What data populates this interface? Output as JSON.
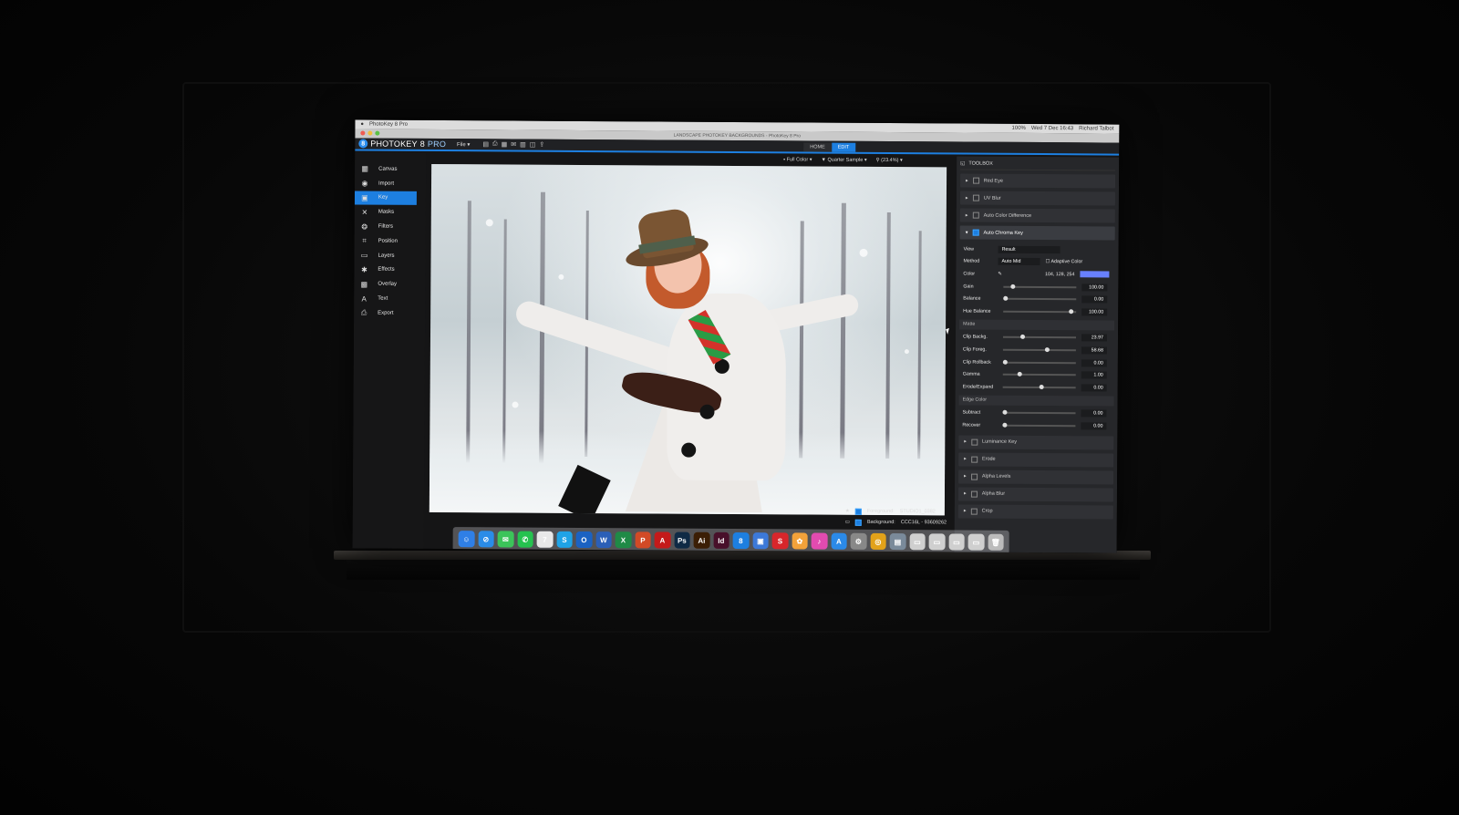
{
  "menubar": {
    "app_name": "PhotoKey 8 Pro",
    "clock": "Wed 7 Dec 16:43",
    "user": "Richard Talbot",
    "battery": "100%"
  },
  "window": {
    "title": "LANDSCAPE PHOTOKEY BACKGROUNDS - PhotoKey 8 Pro"
  },
  "toolbar": {
    "brand_left": "PHOTOKEY",
    "brand_num": "8",
    "brand_pro": "PRO",
    "file_menu": "File ▾",
    "mode_tabs": [
      {
        "label": "HOME"
      },
      {
        "label": "EDIT"
      }
    ]
  },
  "sidebar": {
    "items": [
      {
        "label": "Canvas",
        "icon": "▦"
      },
      {
        "label": "Import",
        "icon": "◉"
      },
      {
        "label": "Key",
        "icon": "▣"
      },
      {
        "label": "Masks",
        "icon": "✕"
      },
      {
        "label": "Filters",
        "icon": "❂"
      },
      {
        "label": "Position",
        "icon": "⌗"
      },
      {
        "label": "Layers",
        "icon": "▭"
      },
      {
        "label": "Effects",
        "icon": "✱"
      },
      {
        "label": "Overlay",
        "icon": "▩"
      },
      {
        "label": "Text",
        "icon": "A"
      },
      {
        "label": "Export",
        "icon": "⎙"
      }
    ]
  },
  "viewbar": {
    "color_mode": "Full Color",
    "sample": "Quarter Sample",
    "zoom": "(23.4%)"
  },
  "status": {
    "foreground_label": "Foreground:",
    "foreground_value": "STUDIO1_0382",
    "background_label": "Background:",
    "background_value": "CCC16L - 93609262"
  },
  "toolbox": {
    "title": "TOOLBOX",
    "top_items": [
      {
        "label": "Red Eye"
      },
      {
        "label": "UV Blur"
      },
      {
        "label": "Auto Color Difference"
      }
    ],
    "open_item": "Auto Chroma Key",
    "view_label": "View",
    "view_value": "Result",
    "method_label": "Method",
    "method_value": "Auto Mid",
    "adaptive_label": "Adaptive Color",
    "color_label": "Color",
    "color_value": "104, 128, 254",
    "swatch_color": "#6880fe",
    "sliders_a": [
      {
        "label": "Gain",
        "value": "100.00"
      },
      {
        "label": "Balance",
        "value": "0.00"
      },
      {
        "label": "Hue Balance",
        "value": "100.00"
      }
    ],
    "matte_label": "Matte",
    "sliders_b": [
      {
        "label": "Clip Backg.",
        "value": "23.97"
      },
      {
        "label": "Clip Foreg.",
        "value": "58.68"
      },
      {
        "label": "Clip Rollback",
        "value": "0.00"
      },
      {
        "label": "Gamma",
        "value": "1.00"
      },
      {
        "label": "Erode/Expand",
        "value": "0.00"
      }
    ],
    "edge_label": "Edge Color",
    "sliders_c": [
      {
        "label": "Subtract",
        "value": "0.00"
      },
      {
        "label": "Recover",
        "value": "0.00"
      }
    ],
    "bottom_items": [
      {
        "label": "Luminance Key"
      },
      {
        "label": "Erode"
      },
      {
        "label": "Alpha Levels"
      },
      {
        "label": "Alpha Blur"
      },
      {
        "label": "Crop"
      }
    ]
  },
  "dock": {
    "icons": [
      {
        "name": "finder",
        "glyph": "☺",
        "color": "#2f7fe6"
      },
      {
        "name": "safari",
        "glyph": "⊘",
        "color": "#2a8ce8"
      },
      {
        "name": "messages",
        "glyph": "✉",
        "color": "#3cc45a"
      },
      {
        "name": "whatsapp",
        "glyph": "✆",
        "color": "#25c24f"
      },
      {
        "name": "calendar",
        "glyph": "7",
        "color": "#e8e8e8"
      },
      {
        "name": "skype",
        "glyph": "S",
        "color": "#1fa3e6"
      },
      {
        "name": "outlook",
        "glyph": "O",
        "color": "#1b62c2"
      },
      {
        "name": "word",
        "glyph": "W",
        "color": "#2b5fb7"
      },
      {
        "name": "excel",
        "glyph": "X",
        "color": "#1f8a46"
      },
      {
        "name": "powerpoint",
        "glyph": "P",
        "color": "#d24a26"
      },
      {
        "name": "acrobat",
        "glyph": "A",
        "color": "#c41a1a"
      },
      {
        "name": "photoshop",
        "glyph": "Ps",
        "color": "#0f2a45"
      },
      {
        "name": "illustrator",
        "glyph": "Ai",
        "color": "#3b1e05"
      },
      {
        "name": "indesign",
        "glyph": "Id",
        "color": "#48102a"
      },
      {
        "name": "photokey",
        "glyph": "8",
        "color": "#1d7fe0"
      },
      {
        "name": "screens",
        "glyph": "▣",
        "color": "#3c79d8"
      },
      {
        "name": "red-app",
        "glyph": "S",
        "color": "#d8262b"
      },
      {
        "name": "photos",
        "glyph": "✿",
        "color": "#f3a23a"
      },
      {
        "name": "itunes",
        "glyph": "♪",
        "color": "#e24bb0"
      },
      {
        "name": "app-store",
        "glyph": "A",
        "color": "#2b8ae8"
      },
      {
        "name": "system-prefs",
        "glyph": "⚙",
        "color": "#888888"
      },
      {
        "name": "chrome",
        "glyph": "◎",
        "color": "#e2a21a"
      },
      {
        "name": "preview",
        "glyph": "▤",
        "color": "#7a8a9a"
      },
      {
        "name": "window-1",
        "glyph": "▭",
        "color": "#cfcfcf"
      },
      {
        "name": "window-2",
        "glyph": "▭",
        "color": "#cfcfcf"
      },
      {
        "name": "window-3",
        "glyph": "▭",
        "color": "#cfcfcf"
      },
      {
        "name": "window-4",
        "glyph": "▭",
        "color": "#cfcfcf"
      },
      {
        "name": "trash",
        "glyph": "🗑",
        "color": "#bbbbbb"
      }
    ]
  },
  "colors": {
    "accent": "#1d7fe0",
    "panel": "#26272a"
  }
}
